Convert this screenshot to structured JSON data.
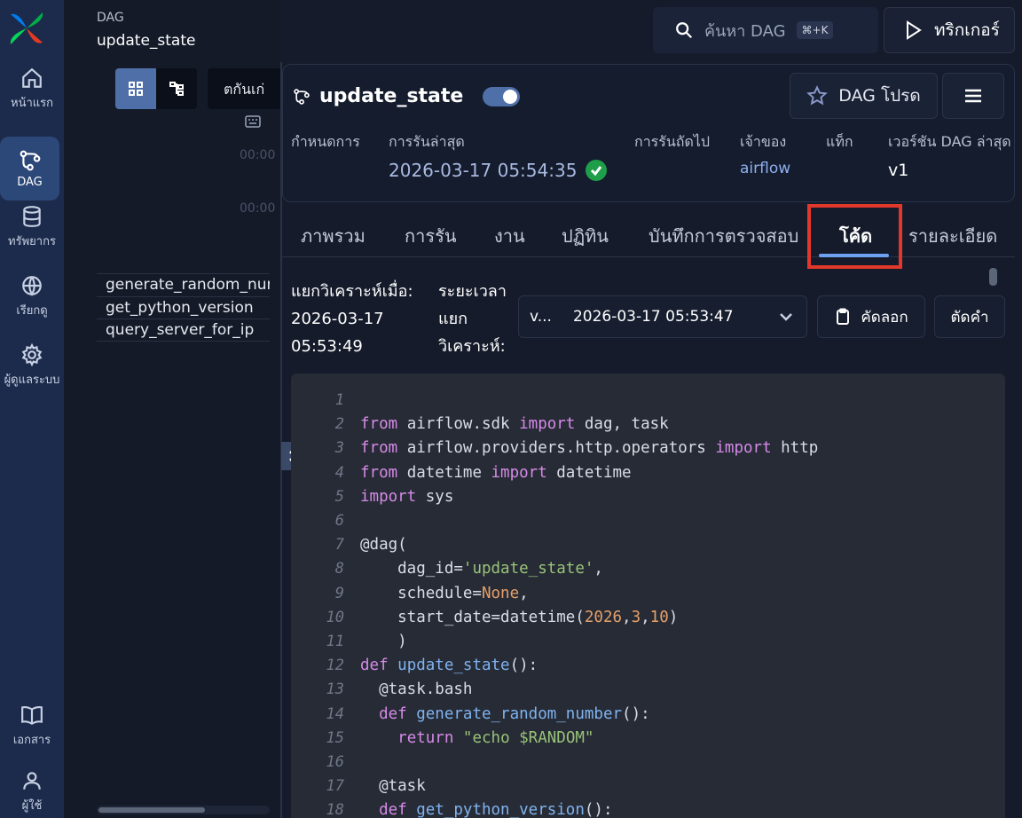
{
  "rail": {
    "home": "หน้าแรก",
    "dags": "DAG",
    "assets": "ทรัพยากร",
    "browse": "เรียกดู",
    "admin": "ผู้ดูแลระบบ",
    "docs": "เอกสาร",
    "user": "ผู้ใช้"
  },
  "breadcrumb": {
    "label": "DAG",
    "value": "update_state"
  },
  "left_panel": {
    "filter_label": "ตกันเก่",
    "ticks": [
      "00:00",
      "00:00"
    ],
    "tasks": [
      "generate_random_number",
      "get_python_version",
      "query_server_for_ip"
    ]
  },
  "topbar": {
    "search_placeholder": "ค้นหา DAG",
    "search_shortcut": "⌘+K",
    "trigger_label": "ทริกเกอร์"
  },
  "dag": {
    "name": "update_state",
    "enabled": true,
    "favorite_label": "DAG โปรด",
    "meta": {
      "schedule_h": "กำหนดการ",
      "last_run_h": "การรันล่าสุด",
      "last_run": "2026-03-17 05:54:35",
      "next_run_h": "การรันถัดไป",
      "owner_h": "เจ้าของ",
      "owner": "airflow",
      "tags_h": "แท็ก",
      "version_h": "เวอร์ชัน DAG ล่าสุด",
      "version": "v1"
    }
  },
  "tabs": [
    "ภาพรวม",
    "การรัน",
    "งาน",
    "ปฏิทิน",
    "บันทึกการตรวจสอบ",
    "โค้ด",
    "รายละเอียด"
  ],
  "active_tab": "โค้ด",
  "code_toolbar": {
    "parsed_at_label": "แยกวิเคราะห์เมื่อ:",
    "parsed_at_date": "2026-03-17",
    "parsed_at_time": "05:53:49",
    "duration_label_1": "ระยะเวลา",
    "duration_label_2": "แยก",
    "duration_label_3": "วิเคราะห์:",
    "version_short": "v...",
    "version_value": "2026-03-17 05:53:47",
    "copy_label": "คัดลอก",
    "wrap_label": "ตัดคำ"
  },
  "code_lines": [
    "",
    "from airflow.sdk import dag, task",
    "from airflow.providers.http.operators import http",
    "from datetime import datetime",
    "import sys",
    "",
    "@dag(",
    "    dag_id='update_state',",
    "    schedule=None,",
    "    start_date=datetime(2026,3,10)",
    "    )",
    "def update_state():",
    "  @task.bash",
    "  def generate_random_number():",
    "    return \"echo $RANDOM\"",
    "",
    "  @task",
    "  def get_python_version():"
  ],
  "colors": {
    "accent": "#4f6fa8",
    "success": "#1f9e4a",
    "highlight_box": "#e0382b",
    "keyword": "#d58ae8",
    "string": "#98c379",
    "number": "#e5a06a"
  }
}
